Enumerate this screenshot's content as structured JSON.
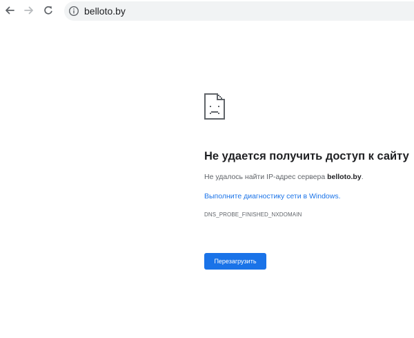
{
  "browser": {
    "url": "belloto.by",
    "icons": {
      "back": "arrow-left-icon",
      "forward": "arrow-right-icon",
      "reload": "reload-icon",
      "site_info": "info-icon"
    }
  },
  "error_page": {
    "icon": "sad-document-icon",
    "title": "Не удается получить доступ к сайту",
    "description_prefix": "Не удалось найти IP-адрес сервера ",
    "description_host": "belloto.by",
    "description_suffix": ".",
    "diagnostics_link": "Выполните диагностику сети в Windows.",
    "error_code": "DNS_PROBE_FINISHED_NXDOMAIN",
    "reload_button": "Перезагрузить"
  },
  "colors": {
    "accent": "#1a73e8",
    "text_primary": "#202124",
    "text_secondary": "#5f6368",
    "omnibox_bg": "#f1f3f4"
  }
}
